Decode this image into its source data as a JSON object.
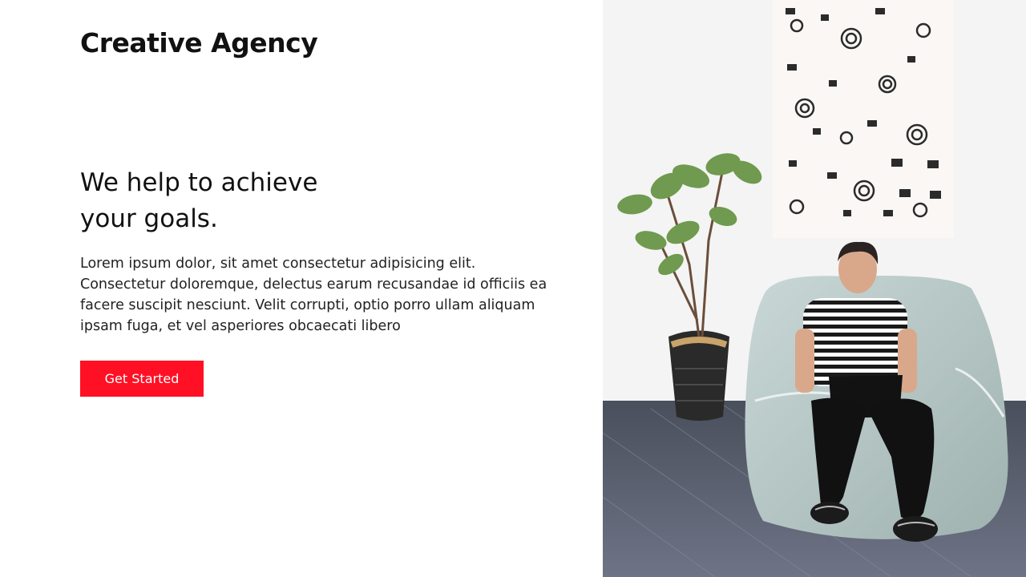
{
  "brand": {
    "name": "Creative Agency"
  },
  "menu": {
    "icon": "hamburger-menu-icon",
    "color": "#ff1024"
  },
  "hero": {
    "heading_line1": "We help to achieve",
    "heading_line2": "your goals.",
    "text_line1": "Lorem ipsum dolor, sit amet consectetur adipisicing elit.",
    "text_line2": "Consectetur doloremque, delectus earum recusandae id officiis ea",
    "text_line3": "facere suscipit nesciunt. Velit corrupti, optio porro ullam aliquam",
    "text_line4": "ipsam fuga, et vel asperiores obcaecati libero",
    "cta_label": "Get Started",
    "cta_color": "#ff1024",
    "image": "man-with-laptop-on-beanbag-photo"
  }
}
